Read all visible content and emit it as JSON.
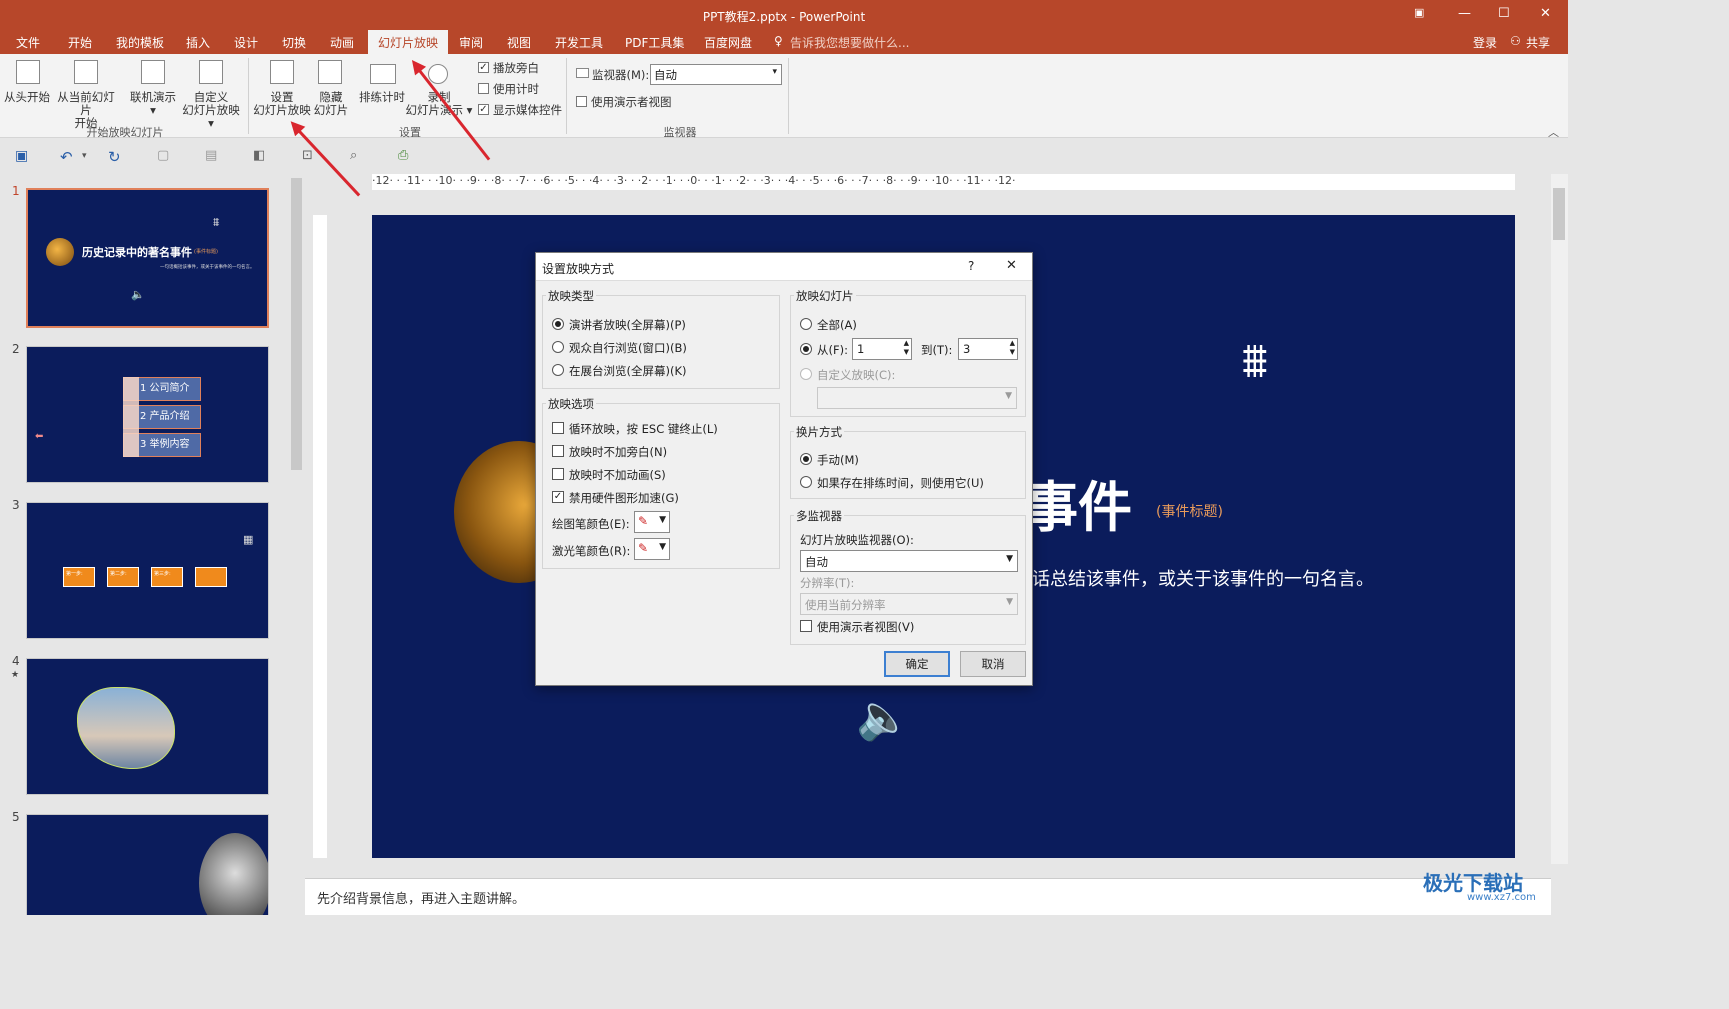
{
  "window": {
    "title": "PPT教程2.pptx - PowerPoint"
  },
  "tabs": [
    "文件",
    "开始",
    "我的模板",
    "插入",
    "设计",
    "切换",
    "动画",
    "幻灯片放映",
    "审阅",
    "视图",
    "开发工具",
    "PDF工具集",
    "百度网盘"
  ],
  "active_tab": "幻灯片放映",
  "tell_me": "告诉我您想要做什么...",
  "account": {
    "login": "登录",
    "share": "共享"
  },
  "ribbon": {
    "from_start": "从头开始",
    "from_current_1": "从当前幻灯片",
    "from_current_2": "开始",
    "online_1": "联机演示",
    "custom_1": "自定义",
    "custom_2": "幻灯片放映",
    "group_start": "开始放映幻灯片",
    "setup_1": "设置",
    "setup_2": "幻灯片放映",
    "hide_1": "隐藏",
    "hide_2": "幻灯片",
    "rehearse": "排练计时",
    "record_1": "录制",
    "record_2": "幻灯片演示",
    "play_narration": "播放旁白",
    "use_timings": "使用计时",
    "show_media": "显示媒体控件",
    "group_setup": "设置",
    "monitor_label": "监视器(M):",
    "monitor_value": "自动",
    "presenter_view": "使用演示者视图",
    "group_monitor": "监视器"
  },
  "thumbnails": {
    "numbers": [
      "1",
      "2",
      "3",
      "4",
      "5"
    ],
    "slide1_title": "历史记录中的著名事件",
    "slide1_tag": "(事件标题)",
    "slide1_sub": "一句话概括该事件，或关于该事件的一句名言。",
    "slide2_items": [
      "1 公司简介",
      "2 产品介绍",
      "3 举例内容"
    ],
    "slide3_steps": [
      "第一步:",
      "第二步:",
      "第三步:"
    ],
    "slide4_star": "★"
  },
  "ruler": {
    "h": "·12·  ·  ·11·  ·  ·10·  ·  ·9·  ·  ·8·  ·  ·7·  ·  ·6·  ·  ·5·  ·  ·4·  ·  ·3·  ·  ·2·  ·  ·1·  ·  ·0·  ·  ·1·  ·  ·2·  ·  ·3·  ·  ·4·  ·  ·5·  ·  ·6·  ·  ·7·  ·  ·8·  ·  ·9·  ·  ·10·  ·  ·11·  ·  ·12·"
  },
  "slide": {
    "title_part": "事件",
    "title_tag": "(事件标题)",
    "subtitle_part": "话总结该事件，或关于该事件的一句名言。"
  },
  "notes": "先介绍背景信息，再进入主题讲解。",
  "watermark": "极光下载站",
  "watermark_url": "www.xz7.com",
  "dialog": {
    "title": "设置放映方式",
    "help": "?",
    "close": "✕",
    "show_type": "放映类型",
    "type_presenter": "演讲者放映(全屏幕)(P)",
    "type_window": "观众自行浏览(窗口)(B)",
    "type_kiosk": "在展台浏览(全屏幕)(K)",
    "show_options": "放映选项",
    "opt_loop": "循环放映，按 ESC 键终止(L)",
    "opt_no_narration": "放映时不加旁白(N)",
    "opt_no_animation": "放映时不加动画(S)",
    "opt_disable_hw": "禁用硬件图形加速(G)",
    "pen_color": "绘图笔颜色(E):",
    "laser_color": "激光笔颜色(R):",
    "show_slides": "放映幻灯片",
    "slides_all": "全部(A)",
    "slides_from": "从(F):",
    "from_value": "1",
    "slides_to": "到(T):",
    "to_value": "3",
    "custom_show": "自定义放映(C):",
    "advance": "换片方式",
    "advance_manual": "手动(M)",
    "advance_timing": "如果存在排练时间，则使用它(U)",
    "multi_monitor": "多监视器",
    "monitor_label": "幻灯片放映监视器(O):",
    "monitor_value": "自动",
    "resolution_label": "分辨率(T):",
    "resolution_value": "使用当前分辨率",
    "use_presenter": "使用演示者视图(V)",
    "ok": "确定",
    "cancel": "取消"
  },
  "colors": {
    "accent": "#b7472a",
    "slide_bg": "#0b1c5c",
    "orange": "#f08a1c",
    "arrow": "#d9262e"
  }
}
